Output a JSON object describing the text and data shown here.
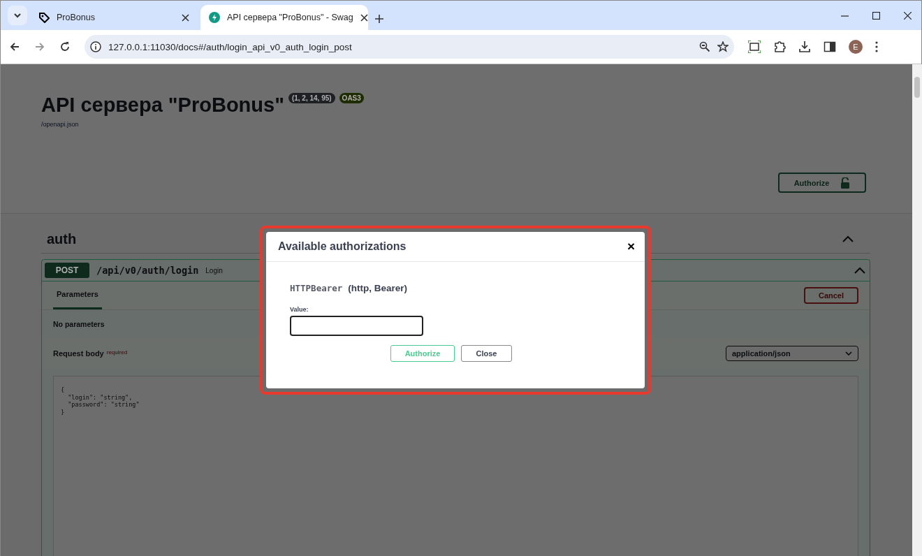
{
  "browser": {
    "tabs": [
      {
        "title": "ProBonus",
        "selected": false
      },
      {
        "title": "API сервера \"ProBonus\" - Swag",
        "selected": true
      }
    ],
    "address": "127.0.0.1:11030/docs#/auth/login_api_v0_auth_login_post",
    "profile_initial": "E"
  },
  "page": {
    "title": "API сервера \"ProBonus\"",
    "version": "(1, 2, 14, 95)",
    "oas": "OAS3",
    "spec_link": "/openapi.json",
    "authorize_button": "Authorize",
    "sections": [
      {
        "name": "auth",
        "expanded": true,
        "operations": [
          {
            "method": "POST",
            "path": "/api/v0/auth/login",
            "summary": "Login",
            "expanded": true,
            "tabs": [
              {
                "label": "Parameters",
                "selected": true
              }
            ],
            "cancel_button": "Cancel",
            "no_parameters": "No parameters",
            "request_body_label": "Request body",
            "required_mark": "required",
            "content_type": "application/json",
            "example": "{\n  \"login\": \"string\",\n  \"password\": \"string\"\n}"
          }
        ]
      }
    ]
  },
  "dialog": {
    "title": "Available authorizations",
    "close": "×",
    "schemes": [
      {
        "name": "HTTPBearer",
        "type": "(http, Bearer)",
        "field_label": "Value:"
      }
    ],
    "authorize_button": "Authorize",
    "close_button": "Close"
  }
}
